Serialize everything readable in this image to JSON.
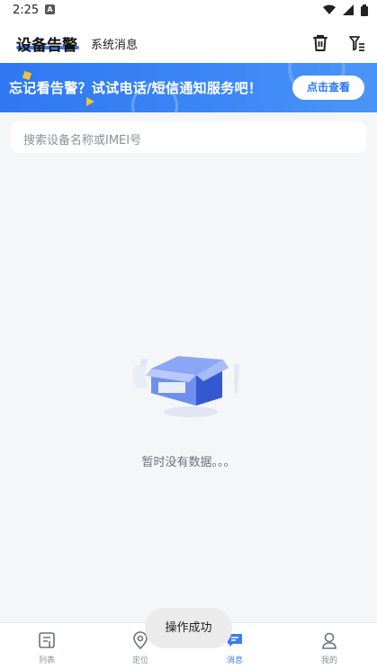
{
  "status_bar": {
    "time": "2:25",
    "notification_glyph": "A"
  },
  "header": {
    "active_tab": "设备告警",
    "inactive_tab": "系统消息",
    "icons": [
      "trash-icon",
      "filter-icon"
    ]
  },
  "banner": {
    "text": "忘记看告警？试试电话/短信通知服务吧！",
    "button": "点击查看"
  },
  "search": {
    "placeholder": "搜索设备名称或IMEI号"
  },
  "empty": {
    "text": "暂时没有数据。。。"
  },
  "bottom_nav": {
    "items": [
      {
        "label": "列表",
        "icon": "list-icon"
      },
      {
        "label": "定位",
        "icon": "location-pin-icon"
      },
      {
        "label": "消息",
        "icon": "message-icon"
      },
      {
        "label": "我的",
        "icon": "user-icon"
      }
    ],
    "active": "消息"
  },
  "toast": {
    "text": "操作成功"
  },
  "colors": {
    "accent": "#3b7cf0",
    "banner": "#2f78f2"
  }
}
